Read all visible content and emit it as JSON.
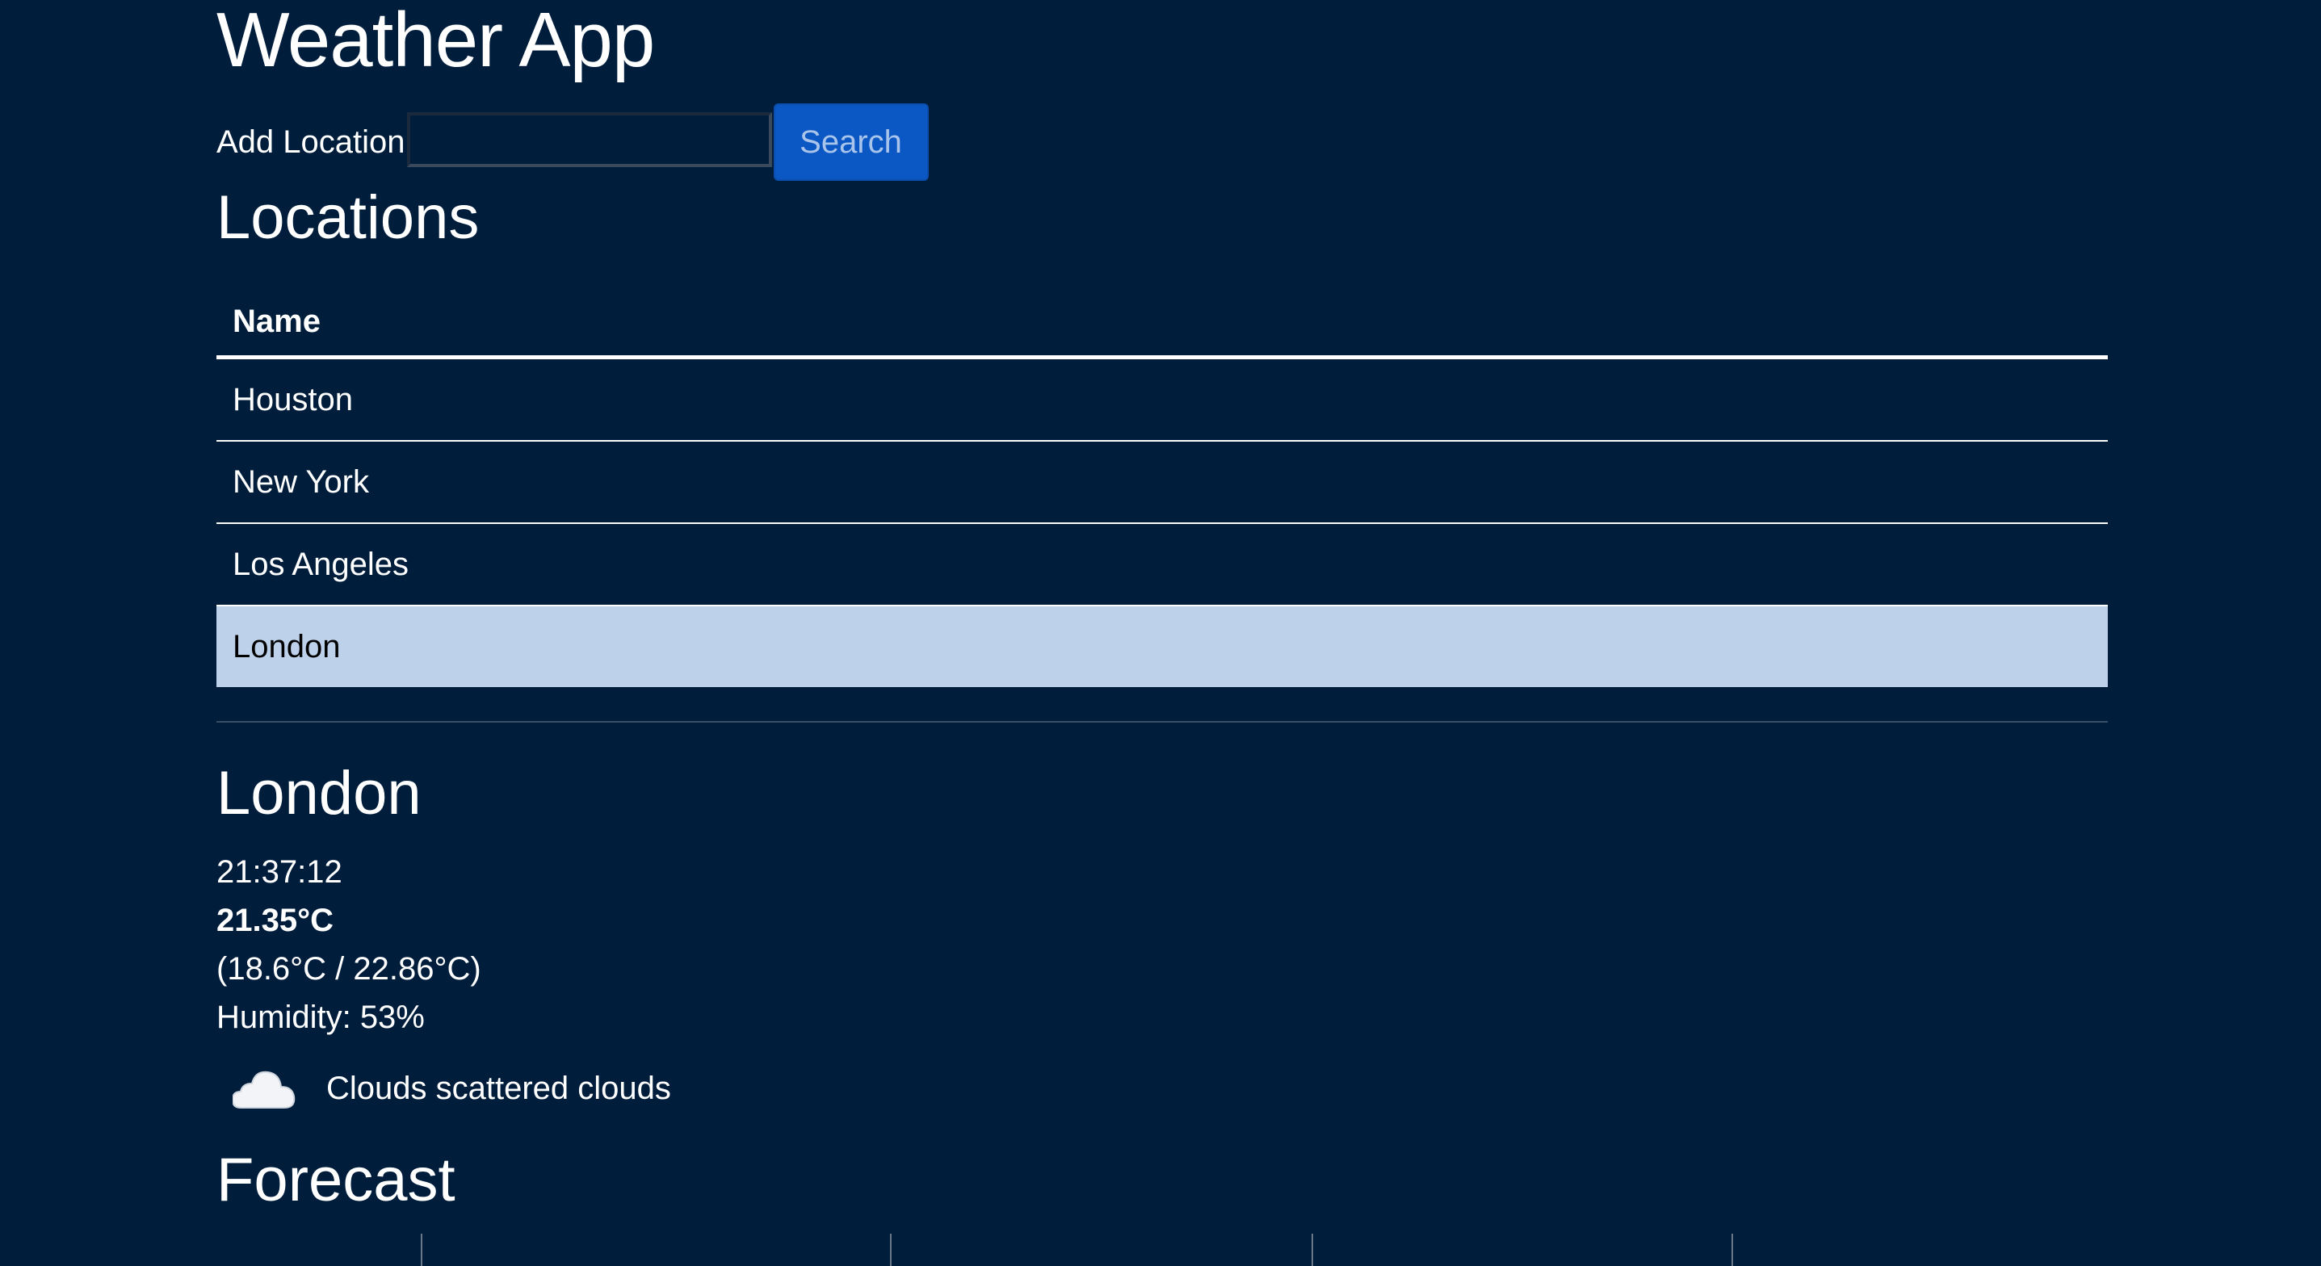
{
  "app": {
    "title": "Weather App"
  },
  "search": {
    "label": "Add Location",
    "value": "",
    "placeholder": "",
    "button_label": "Search"
  },
  "locations": {
    "title": "Locations",
    "column_header": "Name",
    "rows": [
      {
        "name": "Houston",
        "selected": false
      },
      {
        "name": "New York",
        "selected": false
      },
      {
        "name": "Los Angeles",
        "selected": false
      },
      {
        "name": "London",
        "selected": true
      }
    ]
  },
  "detail": {
    "city": "London",
    "time": "21:37:12",
    "temperature": "21.35°C",
    "range": "(18.6°C / 22.86°C)",
    "humidity": "Humidity: 53%",
    "condition": "Clouds scattered clouds",
    "condition_icon": "cloud-icon"
  },
  "forecast": {
    "title": "Forecast"
  },
  "colors": {
    "background": "#001e3c",
    "selected_row": "#bdd1ea",
    "button": "#0b57c4"
  }
}
